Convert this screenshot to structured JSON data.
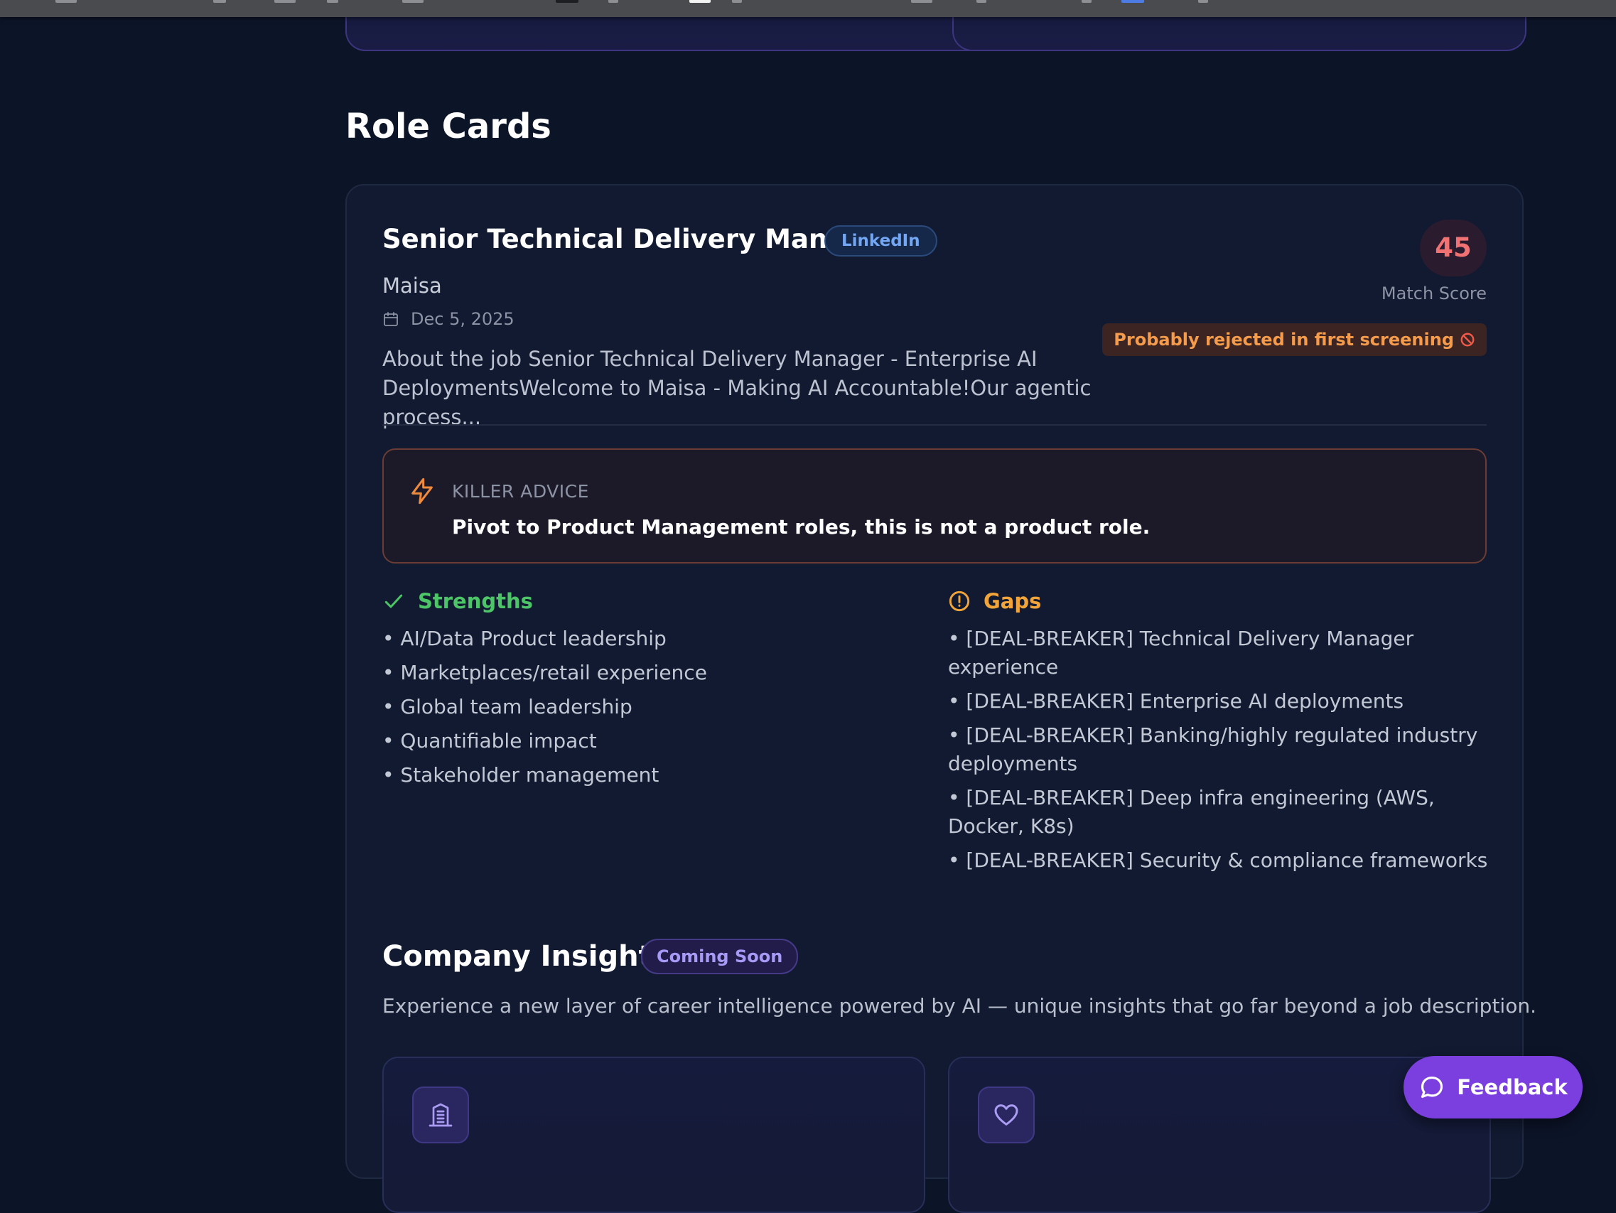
{
  "section_title": "Role Cards",
  "role": {
    "title": "Senior Technical Delivery Manager",
    "source": "LinkedIn",
    "company": "Maisa",
    "date": "Dec 5, 2025",
    "description": "About the job Senior Technical Delivery Manager - Enterprise AI DeploymentsWelcome to Maisa - Making AI Accountable!Our agentic process...",
    "match_score": "45",
    "match_score_label": "Match Score",
    "verdict": "Probably rejected in first screening",
    "advice_label": "KILLER ADVICE",
    "advice_text": "Pivot to Product Management roles, this is not a product role.",
    "strengths_label": "Strengths",
    "strengths": [
      "• AI/Data Product leadership",
      "• Marketplaces/retail experience",
      "• Global team leadership",
      "• Quantifiable impact",
      "• Stakeholder management"
    ],
    "gaps_label": "Gaps",
    "gaps": [
      "• [DEAL-BREAKER] Technical Delivery Manager experience",
      "• [DEAL-BREAKER] Enterprise AI deployments",
      "• [DEAL-BREAKER] Banking/highly regulated industry deployments",
      "• [DEAL-BREAKER] Deep infra engineering (AWS, Docker, K8s)",
      "• [DEAL-BREAKER] Security & compliance frameworks"
    ]
  },
  "insights": {
    "title": "Company Insights",
    "badge": "Coming Soon",
    "subtitle": "Experience a new layer of career intelligence powered by AI — unique insights that go far beyond a job description.",
    "cards": [
      {
        "icon": "building-icon"
      },
      {
        "icon": "heart-icon"
      }
    ]
  },
  "feedback_label": "Feedback",
  "colors": {
    "background": "#0c1428",
    "card": "#111a31",
    "strengths": "#4cc566",
    "gaps": "#f0a43a",
    "score": "#f17272",
    "feedback": "#7a3fde",
    "linkedin": "#73a7f3"
  }
}
